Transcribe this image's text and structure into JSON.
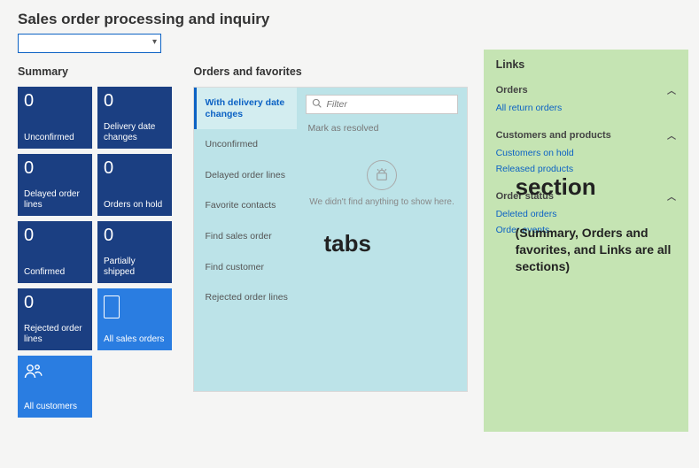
{
  "title": "Sales order processing and inquiry",
  "dropdown": {
    "value": ""
  },
  "summary": {
    "heading": "Summary",
    "tiles": [
      {
        "count": "0",
        "label": "Unconfirmed"
      },
      {
        "count": "0",
        "label": "Delivery date changes"
      },
      {
        "count": "0",
        "label": "Delayed order lines"
      },
      {
        "count": "0",
        "label": "Orders on hold"
      },
      {
        "count": "0",
        "label": "Confirmed"
      },
      {
        "count": "0",
        "label": "Partially shipped"
      },
      {
        "count": "0",
        "label": "Rejected order lines"
      },
      {
        "label": "All sales orders"
      },
      {
        "label": "All customers"
      }
    ]
  },
  "orders": {
    "heading": "Orders and favorites",
    "tabs": [
      "With delivery date changes",
      "Unconfirmed",
      "Delayed order lines",
      "Favorite contacts",
      "Find sales order",
      "Find customer",
      "Rejected order lines"
    ],
    "filter_placeholder": "Filter",
    "mark_resolved": "Mark as resolved",
    "empty_message": "We didn't find anything to show here."
  },
  "links": {
    "heading": "Links",
    "groups": [
      {
        "title": "Orders",
        "items": [
          "All return orders"
        ]
      },
      {
        "title": "Customers and products",
        "items": [
          "Customers on hold",
          "Released products"
        ]
      },
      {
        "title": "Order status",
        "items": [
          "Deleted orders",
          "Order events"
        ]
      }
    ]
  },
  "annotations": {
    "tabs_label": "tabs",
    "section_label": "section",
    "section_desc": "(Summary, Orders and favorites, and Links are all sections)"
  }
}
